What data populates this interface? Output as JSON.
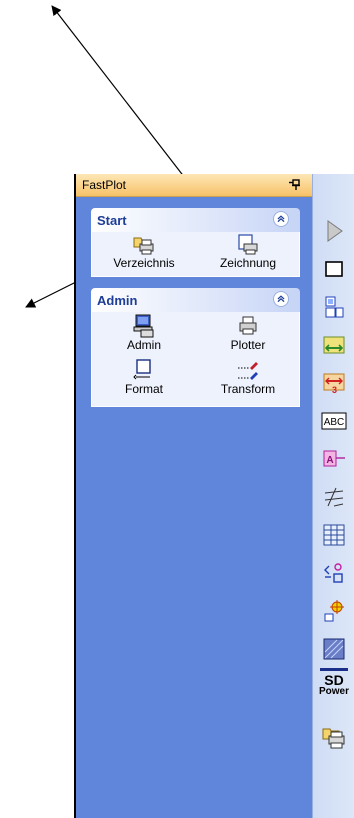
{
  "panel": {
    "title": "FastPlot"
  },
  "groups": {
    "start": {
      "title": "Start",
      "items": [
        {
          "label": "Verzeichnis",
          "icon": "folder-printer-icon"
        },
        {
          "label": "Zeichnung",
          "icon": "drawing-printer-icon"
        }
      ]
    },
    "admin": {
      "title": "Admin",
      "items": [
        {
          "label": "Admin",
          "icon": "computer-admin-icon"
        },
        {
          "label": "Plotter",
          "icon": "printer-icon"
        },
        {
          "label": "Format",
          "icon": "page-format-icon"
        },
        {
          "label": "Transform",
          "icon": "pen-transform-icon"
        }
      ]
    }
  },
  "toolbar": {
    "items": [
      "play-icon",
      "window-icon",
      "layout-icon",
      "measure-icon",
      "dimension-icon",
      "text-abc-icon",
      "attribute-icon",
      "lines-icon",
      "table-icon",
      "symbol-icon",
      "point-icon",
      "hatch-icon",
      "sd-power-logo",
      "fastplot-icon"
    ],
    "abc_label": "ABC",
    "sd_line1": "SD",
    "sd_line2": "Power"
  },
  "colors": {
    "panel_bg": "#5f86da",
    "header_bg": "#f7c268",
    "group_title": "#1e3d96",
    "group_body": "#eef2fc"
  }
}
